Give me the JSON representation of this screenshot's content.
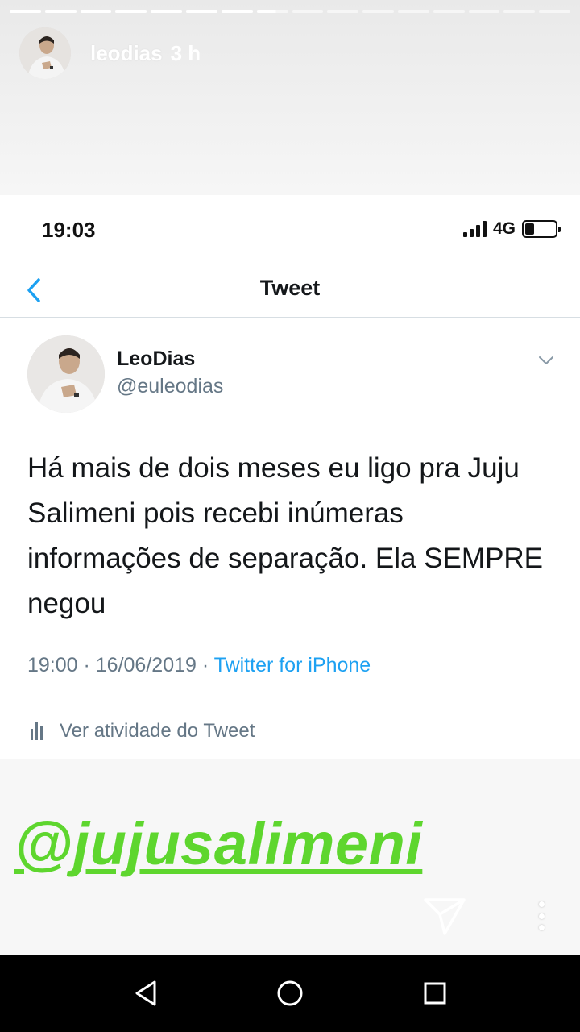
{
  "story": {
    "username": "leodias",
    "time_ago": "3 h",
    "segments_total": 16,
    "segments_done": 7,
    "current_segment_progress": 0.6
  },
  "phone": {
    "status_time": "19:03",
    "network": "4G",
    "battery_level": 0.3,
    "nav_title": "Tweet"
  },
  "tweet": {
    "display_name": "LeoDias",
    "handle": "@euleodias",
    "text": "Há mais de dois meses eu ligo pra Juju Salimeni pois recebi inúmeras informações de separação. Ela SEMPRE negou",
    "timestamp": "19:00 · 16/06/2019 · ",
    "source": "Twitter for iPhone",
    "activity_label": "Ver atividade do Tweet"
  },
  "sticker": {
    "mention": "@jujusalimeni"
  },
  "colors": {
    "twitter_blue": "#1da1f2",
    "meta_gray": "#657786",
    "mention_green": "#5ed62e"
  },
  "icons": [
    "back-chevron-icon",
    "caret-down-icon",
    "activity-chart-icon",
    "send-icon",
    "more-options-icon",
    "android-back-icon",
    "android-home-icon",
    "android-recents-icon"
  ]
}
